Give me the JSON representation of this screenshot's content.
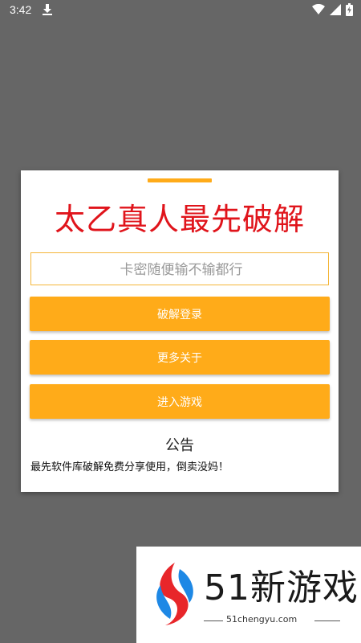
{
  "status_bar": {
    "time": "3:42",
    "icons": [
      "download-icon",
      "wifi-icon",
      "signal-icon",
      "battery-icon"
    ]
  },
  "dialog": {
    "title": "太乙真人最先破解",
    "card_input": {
      "placeholder": "卡密随便输不输都行",
      "value": ""
    },
    "buttons": {
      "login_label": "破解登录",
      "more_label": "更多关于",
      "enter_label": "进入游戏"
    },
    "notice": {
      "title": "公告",
      "text": "最先软件库破解免费分享使用，倒卖没妈！"
    }
  },
  "watermark": {
    "brand": "51新游戏",
    "domain": "51chengyu.com"
  },
  "colors": {
    "overlay": "#666666",
    "accent": "#FFAB19",
    "title_red": "#E0141B",
    "input_border": "#F4B63A",
    "logo_red": "#E8262A",
    "logo_blue": "#1E88E5"
  }
}
